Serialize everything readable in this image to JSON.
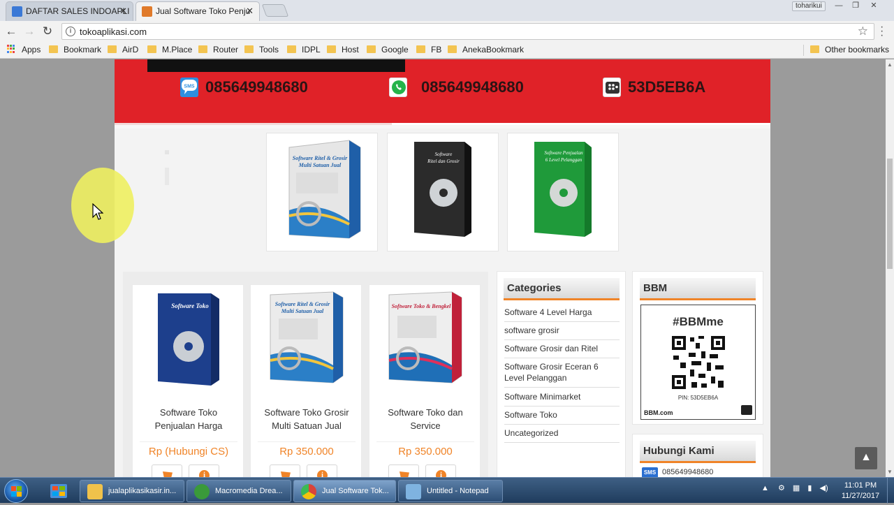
{
  "browser": {
    "tabs": [
      {
        "title": "DAFTAR SALES INDOAPLI",
        "close": "✕",
        "favicon_color": "#3b79d6"
      },
      {
        "title": "Jual Software Toko Penju",
        "close": "✕",
        "favicon_color": "#e07a2a"
      }
    ],
    "user": "toharikui",
    "window_controls": [
      "—",
      "❐",
      "✕"
    ],
    "url": "tokoaplikasi.com",
    "bookmarks_bar": {
      "apps_label": "Apps",
      "items": [
        "Bookmark",
        "AirD",
        "M.Place",
        "Router",
        "Tools",
        "IDPL",
        "Host",
        "Google",
        "FB",
        "AnekaBookmark"
      ],
      "other": "Other bookmarks"
    }
  },
  "site": {
    "contacts": [
      {
        "type": "sms-icon",
        "value": "085649948680",
        "color": "#2e8fe0"
      },
      {
        "type": "whatsapp-icon",
        "value": "085649948680",
        "color": "#25b34a"
      },
      {
        "type": "bbm-icon",
        "value": "53D5EB6A",
        "color": "#333333"
      }
    ],
    "featured": [
      {
        "box_title": "Software Ritel & Grosir Multi Satuan Jual",
        "box_color": "#e8e8e8",
        "accent": "#1f5fa8"
      },
      {
        "box_title": "Software Ritel dan Grosir",
        "box_color": "#2b2b2b",
        "accent": "#3d3d3d"
      },
      {
        "box_title": "Software Penjualan 6 Level Pelanggan",
        "box_color": "#1f9a3a",
        "accent": "#147a2a"
      }
    ],
    "products": [
      {
        "name_line1": "Software Toko",
        "name_line2": "Penjualan Harga",
        "price": "Rp (Hubungi CS)",
        "box_title": "Software Toko",
        "box_color": "#1d3f8c"
      },
      {
        "name_line1": "Software Toko Grosir",
        "name_line2": "Multi Satuan Jual",
        "price": "Rp 350.000",
        "box_title": "Software Ritel & Grosir Multi Satuan Jual",
        "box_color": "#e8e8e8"
      },
      {
        "name_line1": "Software Toko dan",
        "name_line2": "Service",
        "price": "Rp 350.000",
        "box_title": "Software Toko & Bengkel",
        "box_color": "#eeeeee"
      }
    ],
    "categories": {
      "title": "Categories",
      "items": [
        {
          "line1": "Software 4 Level Harga",
          "line2": ""
        },
        {
          "line1": "software grosir",
          "line2": ""
        },
        {
          "line1": "Software Grosir dan Ritel",
          "line2": ""
        },
        {
          "line1": "Software Grosir Eceran 6",
          "line2": "Level Pelanggan"
        },
        {
          "line1": "Software Minimarket",
          "line2": ""
        },
        {
          "line1": "Software Toko",
          "line2": ""
        },
        {
          "line1": "Uncategorized",
          "line2": ""
        }
      ]
    },
    "bbm_widget": {
      "title": "BBM",
      "hashtag": "#BBMme",
      "pin": "PIN: 53D5EB6A",
      "brand": "BBM.com"
    },
    "hubungi": {
      "title": "Hubungi Kami",
      "sms_label": "SMS",
      "phone": "085649948680"
    },
    "scroll_top_icon": "▲"
  },
  "taskbar": {
    "tasks": [
      {
        "label": "jualaplikasikasir.in...",
        "icon": "folder-icon",
        "color": "#f0c24b"
      },
      {
        "label": "Macromedia Drea...",
        "icon": "dreamweaver-icon",
        "color": "#3a9a3a"
      },
      {
        "label": "Jual Software Tok...",
        "icon": "chrome-icon",
        "color": "#d9443a"
      },
      {
        "label": "Untitled - Notepad",
        "icon": "notepad-icon",
        "color": "#7fb3e0"
      }
    ],
    "time": "11:01 PM",
    "date": "11/27/2017"
  }
}
